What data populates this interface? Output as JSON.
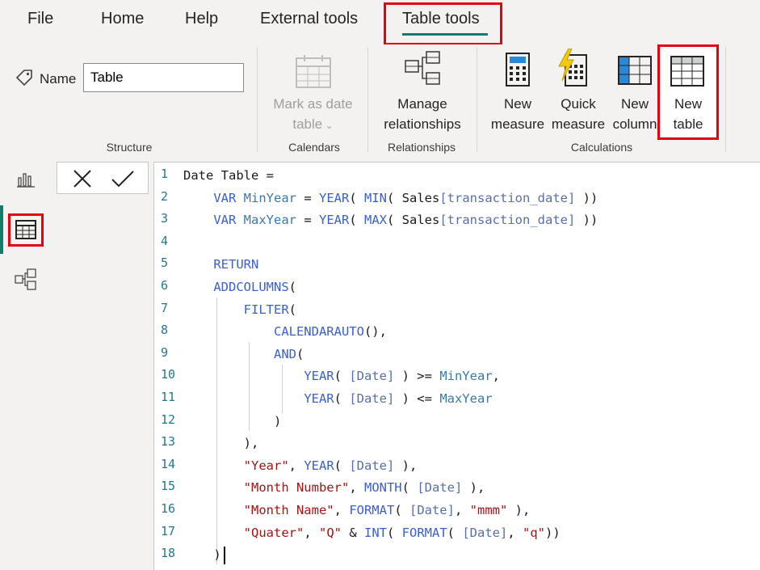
{
  "menu": {
    "tabs": [
      "File",
      "Home",
      "Help",
      "External tools",
      "Table tools"
    ]
  },
  "ribbon": {
    "name_label": "Name",
    "name_value": "Table",
    "groups": {
      "structure": "Structure",
      "calendars": "Calendars",
      "relationships": "Relationships",
      "calculations": "Calculations"
    },
    "buttons": {
      "mark_as_date": [
        "Mark as date",
        "table"
      ],
      "manage_relationships": [
        "Manage",
        "relationships"
      ],
      "new_measure": [
        "New",
        "measure"
      ],
      "quick_measure": [
        "Quick",
        "measure"
      ],
      "new_column": [
        "New",
        "column"
      ],
      "new_table": [
        "New",
        "table"
      ]
    }
  },
  "formula_bar": {
    "cancel_icon": "close-icon",
    "commit_icon": "check-icon"
  },
  "code": {
    "line_numbers": [
      "1",
      "2",
      "3",
      "4",
      "5",
      "6",
      "7",
      "8",
      "9",
      "10",
      "11",
      "12",
      "13",
      "14",
      "15",
      "16",
      "17",
      "18"
    ],
    "lines": [
      "Date Table =",
      "    VAR MinYear = YEAR( MIN( Sales[transaction_date] ))",
      "    VAR MaxYear = YEAR( MAX( Sales[transaction_date] ))",
      "",
      "    RETURN",
      "    ADDCOLUMNS(",
      "        FILTER(",
      "            CALENDARAUTO(),",
      "            AND(",
      "                YEAR( [Date] ) >= MinYear,",
      "                YEAR( [Date] ) <= MaxYear",
      "            )",
      "        ),",
      "        \"Year\", YEAR( [Date] ),",
      "        \"Month Number\", MONTH( [Date] ),",
      "        \"Month Name\", FORMAT( [Date], \"mmm\" ),",
      "        \"Quater\", \"Q\" & INT( FORMAT( [Date], \"q\"))",
      "    )"
    ]
  },
  "colors": {
    "highlight": "#e3000f",
    "accent": "#107c6c"
  }
}
